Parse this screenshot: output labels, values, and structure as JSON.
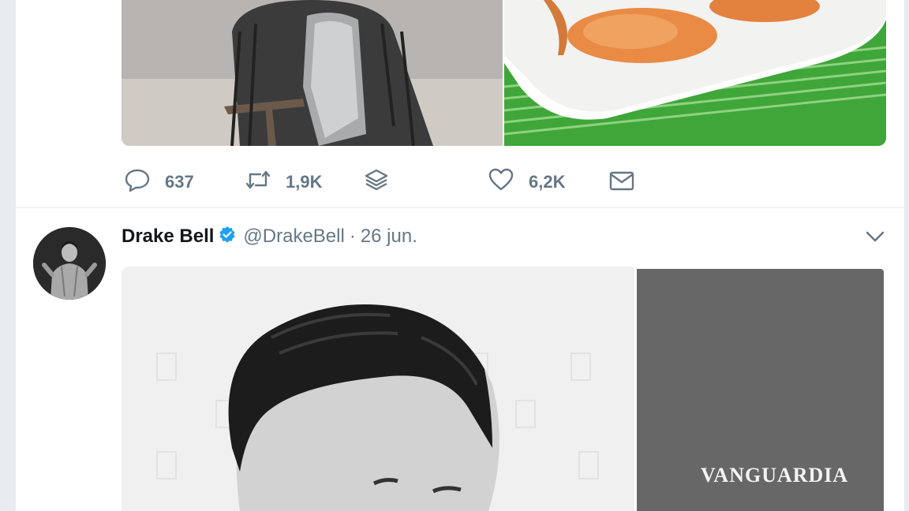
{
  "first_tweet": {
    "actions": {
      "reply_count": "637",
      "retweet_count": "1,9K",
      "like_count": "6,2K"
    }
  },
  "second_tweet": {
    "author_name": "Drake Bell",
    "author_handle": "@DrakeBell",
    "separator": "·",
    "date": "26 jun."
  },
  "watermark": "VANGUARDIA",
  "colors": {
    "text_secondary": "#657786",
    "verified_blue": "#1da1f2",
    "page_background": "#e6ecf0"
  },
  "icons": [
    "reply-icon",
    "retweet-icon",
    "stack-icon",
    "heart-icon",
    "envelope-icon",
    "verified-badge-icon",
    "chevron-down-icon"
  ]
}
